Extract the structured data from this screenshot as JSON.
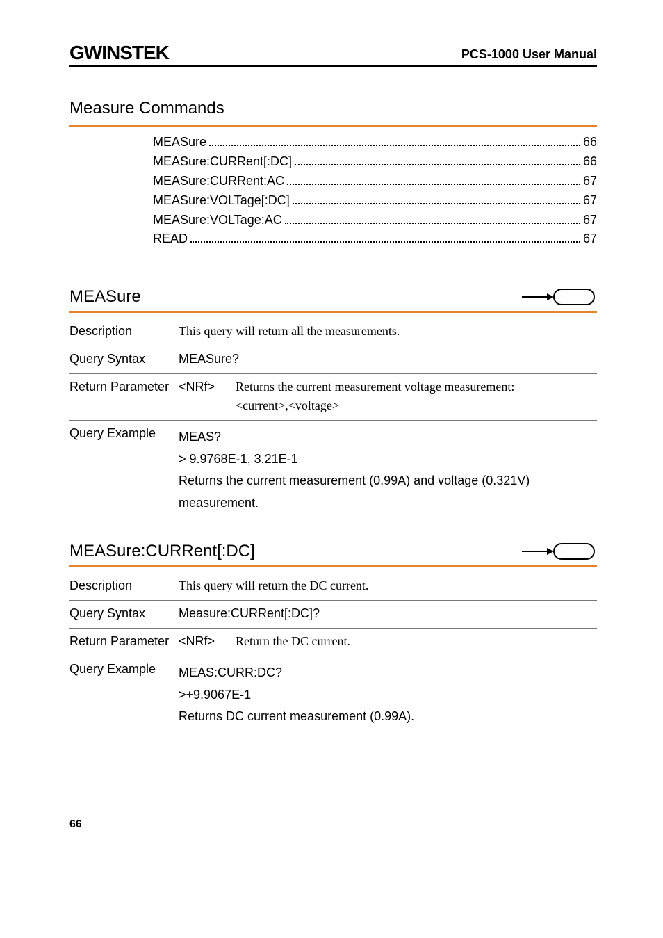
{
  "header": {
    "logo": "GWINSTEK",
    "manual_title": "PCS-1000 User Manual"
  },
  "section_title": "Measure Commands",
  "toc": [
    {
      "label": "MEASure",
      "page": "66"
    },
    {
      "label": "MEASure:CURRent[:DC]",
      "page": "66"
    },
    {
      "label": "MEASure:CURRent:AC",
      "page": "67"
    },
    {
      "label": "MEASure:VOLTage[:DC]",
      "page": "67"
    },
    {
      "label": "MEASure:VOLTage:AC",
      "page": "67"
    },
    {
      "label": "READ",
      "page": "67"
    }
  ],
  "cmd1": {
    "name": "MEASure",
    "desc_label": "Description",
    "desc_text": "This query will return all the measurements.",
    "qs_label": "Query Syntax",
    "qs_text": "MEASure?",
    "rp_label": "Return Parameter",
    "rp_type": "<NRf>",
    "rp_text1": "Returns the current measurement voltage measurement:",
    "rp_text2": "<current>,<voltage>",
    "qe_label": "Query Example",
    "qe_line1": "MEAS?",
    "qe_line2": "> 9.9768E-1, 3.21E-1",
    "qe_line3": "Returns the current measurement (0.99A) and voltage (0.321V) measurement."
  },
  "cmd2": {
    "name": "MEASure:CURRent[:DC]",
    "desc_label": "Description",
    "desc_text": "This query will return the DC current.",
    "qs_label": "Query Syntax",
    "qs_text": "Measure:CURRent[:DC]?",
    "rp_label": "Return Parameter",
    "rp_type": "<NRf>",
    "rp_text": "Return the DC current.",
    "qe_label": "Query Example",
    "qe_line1": "MEAS:CURR:DC?",
    "qe_line2": ">+9.9067E-1",
    "qe_line3": "Returns DC current measurement (0.99A)."
  },
  "page_number": "66"
}
